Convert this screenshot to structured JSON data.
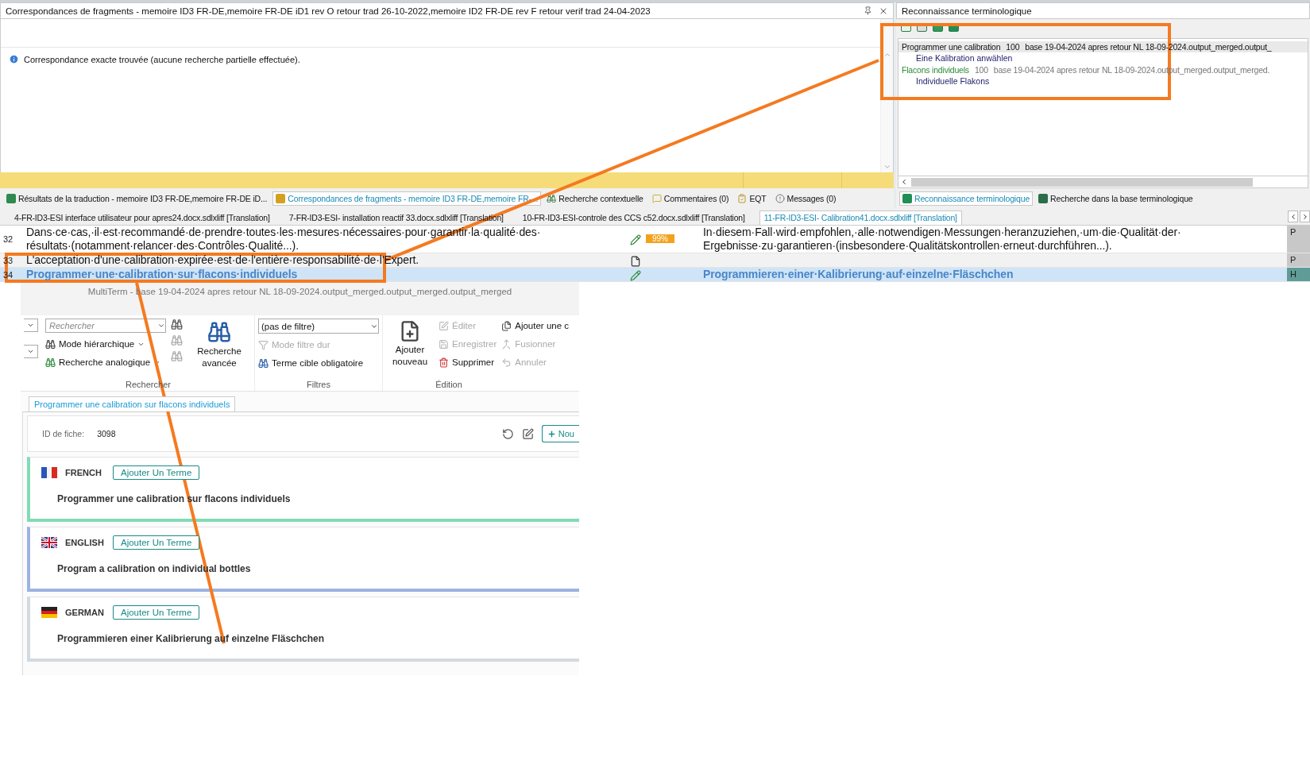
{
  "fragment_panel": {
    "title": "Correspondances de fragments - memoire ID3 FR-DE,memoire FR-DE iD1 rev O retour trad 26-10-2022,memoire ID2 FR-DE rev F retour verif trad 24-04-2023",
    "message": "Correspondance exacte trouvée (aucune recherche partielle effectuée)."
  },
  "term_panel": {
    "title": "Reconnaissance terminologique",
    "hits": [
      {
        "term": "Programmer une calibration",
        "score": "100",
        "source": "base 19-04-2024 apres retour NL 18-09-2024.output_merged.output_",
        "translation": "Eine Kalibration anwählen",
        "selected": true
      },
      {
        "term": "Flacons individuels",
        "score": "100",
        "source": "base 19-04-2024 apres retour NL 18-09-2024.output_merged.output_merged.",
        "translation": "Individuelle Flakons",
        "selected": false
      }
    ]
  },
  "panel_tabs": [
    {
      "kind": "results",
      "label": "Résultats de la traduction - memoire ID3 FR-DE,memoire FR-DE iD...",
      "selected": false
    },
    {
      "kind": "fragments",
      "label": "Correspondances de fragments - memoire ID3 FR-DE,memoire FR-...",
      "selected": true
    },
    {
      "kind": "context",
      "label": "Recherche contextuelle",
      "selected": false
    },
    {
      "kind": "comments",
      "label": "Commentaires (0)",
      "selected": false
    },
    {
      "kind": "eqt",
      "label": "EQT",
      "selected": false
    },
    {
      "kind": "messages",
      "label": "Messages (0)",
      "selected": false
    }
  ],
  "term_tabs": [
    {
      "kind": "termrec",
      "label": "Reconnaissance terminologique",
      "selected": true
    },
    {
      "kind": "termsearch",
      "label": "Recherche dans la base terminologique",
      "selected": false
    }
  ],
  "file_tabs": [
    {
      "label": "4-FR-ID3-ESI interface utilisateur pour apres24.docx.sdlxliff [Translation]",
      "selected": false
    },
    {
      "label": "7-FR-ID3-ESI- installation reactif 33.docx.sdlxliff [Translation]",
      "selected": false
    },
    {
      "label": "10-FR-ID3-ESI-controle des CCS c52.docx.sdlxliff [Translation]",
      "selected": false
    },
    {
      "label": "11-FR-ID3-ESI- Calibration41.docx.sdlxliff [Translation]",
      "selected": true
    }
  ],
  "segments": [
    {
      "number": "32",
      "source": [
        "Dans·ce·cas,·il·est·recommandé·de·prendre·toutes·les·mesures·nécessaires·pour·garantir·la·qualité·des·",
        "résultats·(notamment·relancer·des·Contrôles·Qualité...)."
      ],
      "kind": "translated",
      "match": "99%",
      "target": [
        "In·diesem·Fall·wird·empfohlen,·alle·notwendigen·Messungen·heranzuziehen,·um·die·Qualität·der·",
        "Ergebnisse·zu·garantieren·(insbesondere·Qualitätskontrollen·erneut·durchführen...)."
      ],
      "flag": "P",
      "selected": false
    },
    {
      "number": "33",
      "source": [
        "L'acceptation·d'une·calibration·expirée·est·de·l'entière·responsabilité·de·l'Expert."
      ],
      "kind": "not_translated",
      "flag": "P",
      "selected": false
    },
    {
      "number": "34",
      "source": [
        "Programmer·une·calibration·sur·flacons·individuels"
      ],
      "kind": "translated",
      "target": [
        "Programmieren·einer·Kalibrierung·auf·einzelne·Fläschchen"
      ],
      "flag": "H",
      "selected": true
    }
  ],
  "multiterm": {
    "title": "MultiTerm - base 19-04-2024 apres retour NL 18-09-2024.output_merged.output_merged.output_merged",
    "search_placeholder": "Rechercher",
    "modes": [
      "Mode hiérarchique",
      "Recherche analogique"
    ],
    "advanced": "Recherche avancée",
    "search_group": "Rechercher",
    "filter_value": "(pas de filtre)",
    "filter_items": [
      {
        "label": "Mode filtre dur",
        "disabled": true
      },
      {
        "label": "Terme cible obligatoire",
        "disabled": false
      }
    ],
    "filter_group": "Filtres",
    "add_new": "Ajouter nouveau",
    "edit_items": [
      {
        "kind": "edit",
        "label": "Éditer",
        "disabled": true
      },
      {
        "kind": "save",
        "label": "Enregistrer",
        "disabled": true
      },
      {
        "kind": "delete",
        "label": "Supprimer",
        "disabled": false
      },
      {
        "kind": "add",
        "label": "Ajouter une c",
        "disabled": false
      },
      {
        "kind": "merge",
        "label": "Fusionner",
        "disabled": true
      },
      {
        "kind": "undo",
        "label": "Annuler",
        "disabled": true
      }
    ],
    "edit_group": "Édition",
    "entry_tab": "Programmer une calibration sur flacons individuels",
    "id_label": "ID de fiche:",
    "id_value": "3098",
    "new_button": "Nou",
    "languages": [
      {
        "kind": "fr",
        "name": "FRENCH",
        "color": "#82dbb7",
        "add_label": "Ajouter Un Terme",
        "term": "Programmer une calibration sur flacons individuels"
      },
      {
        "kind": "gb",
        "name": "ENGLISH",
        "color": "#9db2e2",
        "add_label": "Ajouter Un Terme",
        "term": "Program a calibration on individual bottles"
      },
      {
        "kind": "de",
        "name": "GERMAN",
        "color": "#d3dadf",
        "add_label": "Ajouter Un Terme",
        "term": "Programmieren einer Kalibrierung auf einzelne Fläschchen"
      }
    ]
  }
}
